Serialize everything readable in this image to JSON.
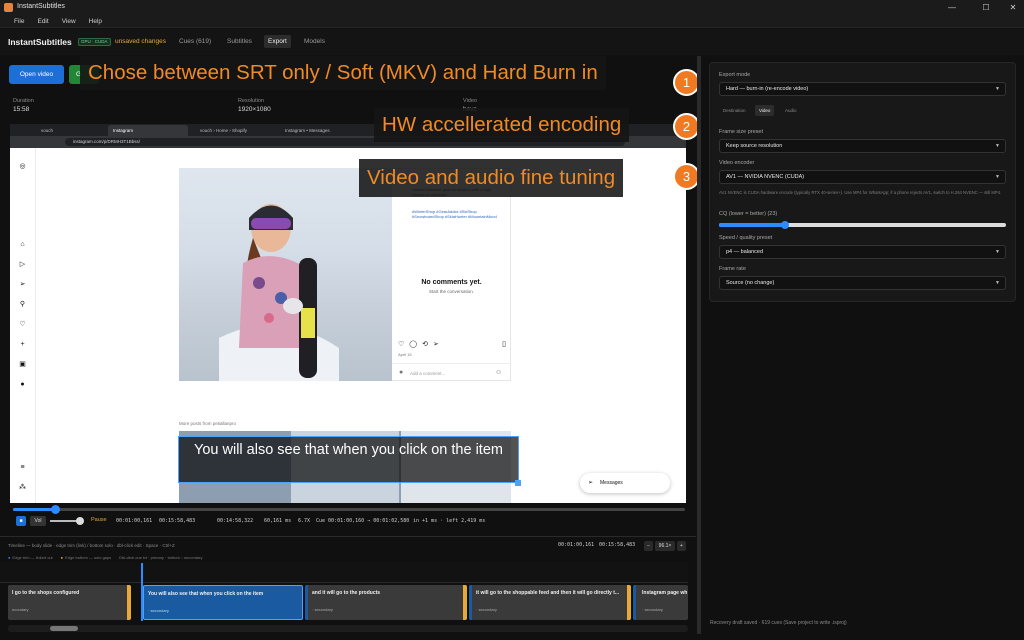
{
  "window": {
    "title": "InstantSubtitles"
  },
  "menu": [
    "File",
    "Edit",
    "View",
    "Help"
  ],
  "header": {
    "brand": "InstantSubtitles",
    "gpu_badge": "GPU · CUDA",
    "unsaved": "unsaved changes",
    "tabs": [
      {
        "label": "Cues (619)",
        "active": false
      },
      {
        "label": "Subtitles",
        "active": false
      },
      {
        "label": "Export",
        "active": true
      },
      {
        "label": "Models",
        "active": false
      }
    ]
  },
  "toolbar": {
    "open_video": "Open video",
    "green_button": "G"
  },
  "info": {
    "duration_label": "Duration",
    "duration_value": "15:58",
    "resolution_label": "Resolution",
    "resolution_value": "1920×1080",
    "video_label": "Video",
    "video_value": "hevc"
  },
  "callouts": [
    {
      "number": "1",
      "text": "Chose between SRT only / Soft (MKV) and Hard Burn in"
    },
    {
      "number": "2",
      "text": "HW accellerated encoding"
    },
    {
      "number": "3",
      "text": "Video and audio fine tuning"
    }
  ],
  "browser": {
    "tabs": [
      "vouch",
      "Instagram",
      "vouch › Home › Shopify",
      "Instagram • Messages"
    ],
    "url": "instagram.com/p/DRMH3T1Bbss/",
    "post": {
      "caption": "Current forecast: gear temptation with a high chance of checkout.",
      "tags": "#WinterShop #GearAddict #SkiShop #SnowboardShop #SkiaHunter #MountainMood",
      "no_comments": "No comments yet.",
      "start_conversation": "Start the conversation.",
      "date": "April 15",
      "add_comment": "Add a comment..."
    },
    "more_posts": "More posts from petiallanpro",
    "messages": "Messages"
  },
  "subtitle_overlay": "You will also see that when you click on the item",
  "transport": {
    "play_icon_label": "■",
    "vol": "Vol",
    "state": "Pause",
    "time_current": "00:01:00,161",
    "time_total": "00:15:58,483",
    "time_remaining": "00:14:58,322",
    "fps": "60,161 ms",
    "speed": "6.7X",
    "cue_range": "Cue 00:01:00,160 → 00:01:02,580",
    "cue_offset": "in +1 ms · left 2,419 ms",
    "seek_progress": 0.063,
    "volume": 0.8
  },
  "timeline": {
    "help": "Timeline — body slide · edge trim (link) / bottom solo · dbl-click edit · Space · Ctrl+Z",
    "legend_a": "Edge trim — linked cut",
    "legend_b": "Edge bottom — solo gaps",
    "legend_c": "Dbl-click cue txt · primary · bottom ↓ secondary",
    "time_a": "00:01:00,161",
    "time_b": "00:15:58,483",
    "zoom": "96.1×",
    "minus": "−",
    "plus": "+",
    "cues": [
      {
        "text": "l go to the shops configured",
        "sub": "econdary",
        "selected": false
      },
      {
        "text": "You will also see that when you click on the item",
        "sub": "· secondary",
        "selected": true
      },
      {
        "text": "and it will go to the products",
        "sub": "· secondary",
        "selected": false
      },
      {
        "text": "it will go to the shoppable feed and then it will go directly t...",
        "sub": "· secondary",
        "selected": false
      },
      {
        "text": "Instagram page wh",
        "sub": "· secondary",
        "selected": false
      }
    ]
  },
  "export_panel": {
    "export_mode_label": "Export mode",
    "export_mode_value": "Hard — burn-in (re-encode video)",
    "subtabs": [
      {
        "label": "Destination",
        "active": false
      },
      {
        "label": "Video",
        "active": true
      },
      {
        "label": "Audio",
        "active": false
      }
    ],
    "frame_size_label": "Frame size preset",
    "frame_size_value": "Keep source resolution",
    "encoder_label": "Video encoder",
    "encoder_value": "AV1 — NVIDIA NVENC (CUDA)",
    "encoder_note": "AV1 NVENC is CUDA hardware encode (typically RTX 40-series+). Use MP4 for WhatsApp; if a phone rejects AV1, switch to H.264 NVENC — still MP4.",
    "cq_label": "CQ (lower = better) (23)",
    "cq_value": 23,
    "cq_range": [
      0,
      100
    ],
    "preset_label": "Speed / quality preset",
    "preset_value": "p4 — balanced",
    "framerate_label": "Frame rate",
    "framerate_value": "Source (no change)"
  },
  "status": "Recovery draft saved · 619 cues (Save project to write .isproj)",
  "colors": {
    "accent": "#2b8cff",
    "callout": "#f08a24",
    "unsaved": "#e6a93a"
  }
}
